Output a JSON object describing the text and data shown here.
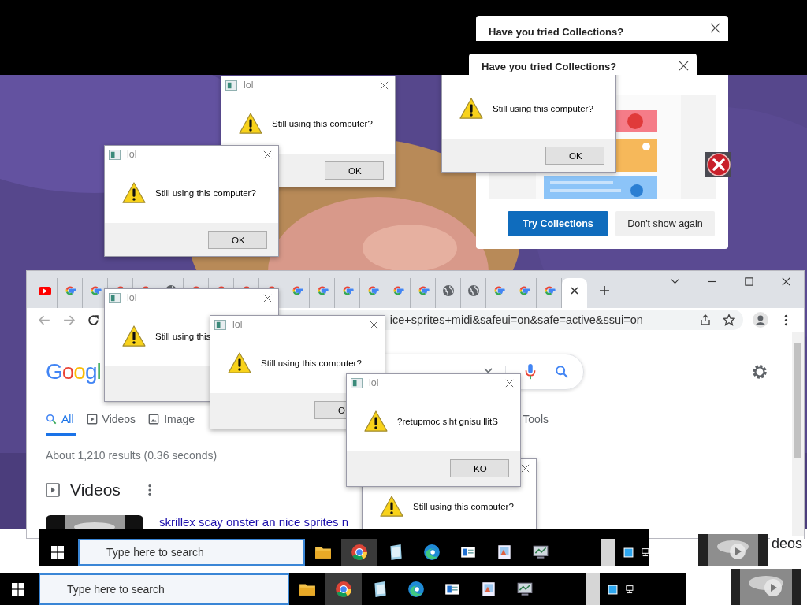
{
  "collections_popups": [
    {
      "title": "Have you tried Collections?"
    },
    {
      "title": "Have you tried Collections?"
    }
  ],
  "collections_panel": {
    "buttons": [
      {
        "label": "Try Collections",
        "kind": "primary"
      },
      {
        "label": "Don't show again",
        "kind": "secondary"
      }
    ]
  },
  "dialogs": [
    {
      "message": "Still using this computer?",
      "button": "OK"
    },
    {
      "title": "lol",
      "message": "Still using this computer?",
      "button": "OK"
    },
    {
      "title": "lol",
      "message": "Still using this computer?",
      "button": "OK"
    },
    {
      "title": "lol",
      "message": "Still using this"
    },
    {
      "title": "lol",
      "message": "Still using this computer?",
      "button": "O"
    },
    {
      "title": "lol",
      "message": "?retupmoc siht gnisu llitS",
      "button": "KO"
    },
    {
      "message": "Still using this computer?"
    }
  ],
  "browser": {
    "tabs": [
      {
        "kind": "youtube",
        "selected": false
      },
      {
        "kind": "google",
        "selected": false
      },
      {
        "kind": "google",
        "selected": false
      },
      {
        "kind": "google",
        "selected": false
      },
      {
        "kind": "google",
        "selected": false
      },
      {
        "kind": "globe",
        "selected": false
      },
      {
        "kind": "google",
        "selected": false
      },
      {
        "kind": "google",
        "selected": false
      },
      {
        "kind": "google",
        "selected": false
      },
      {
        "kind": "google",
        "selected": false
      },
      {
        "kind": "google",
        "selected": false
      },
      {
        "kind": "google",
        "selected": false
      },
      {
        "kind": "google",
        "selected": false
      },
      {
        "kind": "google",
        "selected": false
      },
      {
        "kind": "google",
        "selected": false
      },
      {
        "kind": "google",
        "selected": false
      },
      {
        "kind": "globe",
        "selected": false
      },
      {
        "kind": "globe",
        "selected": false
      },
      {
        "kind": "google",
        "selected": false
      },
      {
        "kind": "google",
        "selected": false
      },
      {
        "kind": "google",
        "selected": false
      },
      {
        "selected": true
      }
    ],
    "address": "ice+sprites+midi&safeui=on&safe=active&ssui=on",
    "logo": "Googl",
    "search_tabs": [
      {
        "label": "All",
        "kind": "all",
        "selected": true
      },
      {
        "label": "Videos",
        "kind": "videos",
        "selected": false
      },
      {
        "label": "Image",
        "kind": "images",
        "selected": false
      },
      {
        "label": "Tools",
        "kind": "tools",
        "selected": false
      }
    ],
    "result_stats": "About 1,210 results (0.36 seconds)",
    "videos_heading": "Videos",
    "video_title": "skrillex scay onster an nice sprites n"
  },
  "taskbars": [
    {
      "search_placeholder": "Type here to search"
    },
    {
      "search_placeholder": "Type here to search"
    }
  ],
  "side_label": "deos"
}
